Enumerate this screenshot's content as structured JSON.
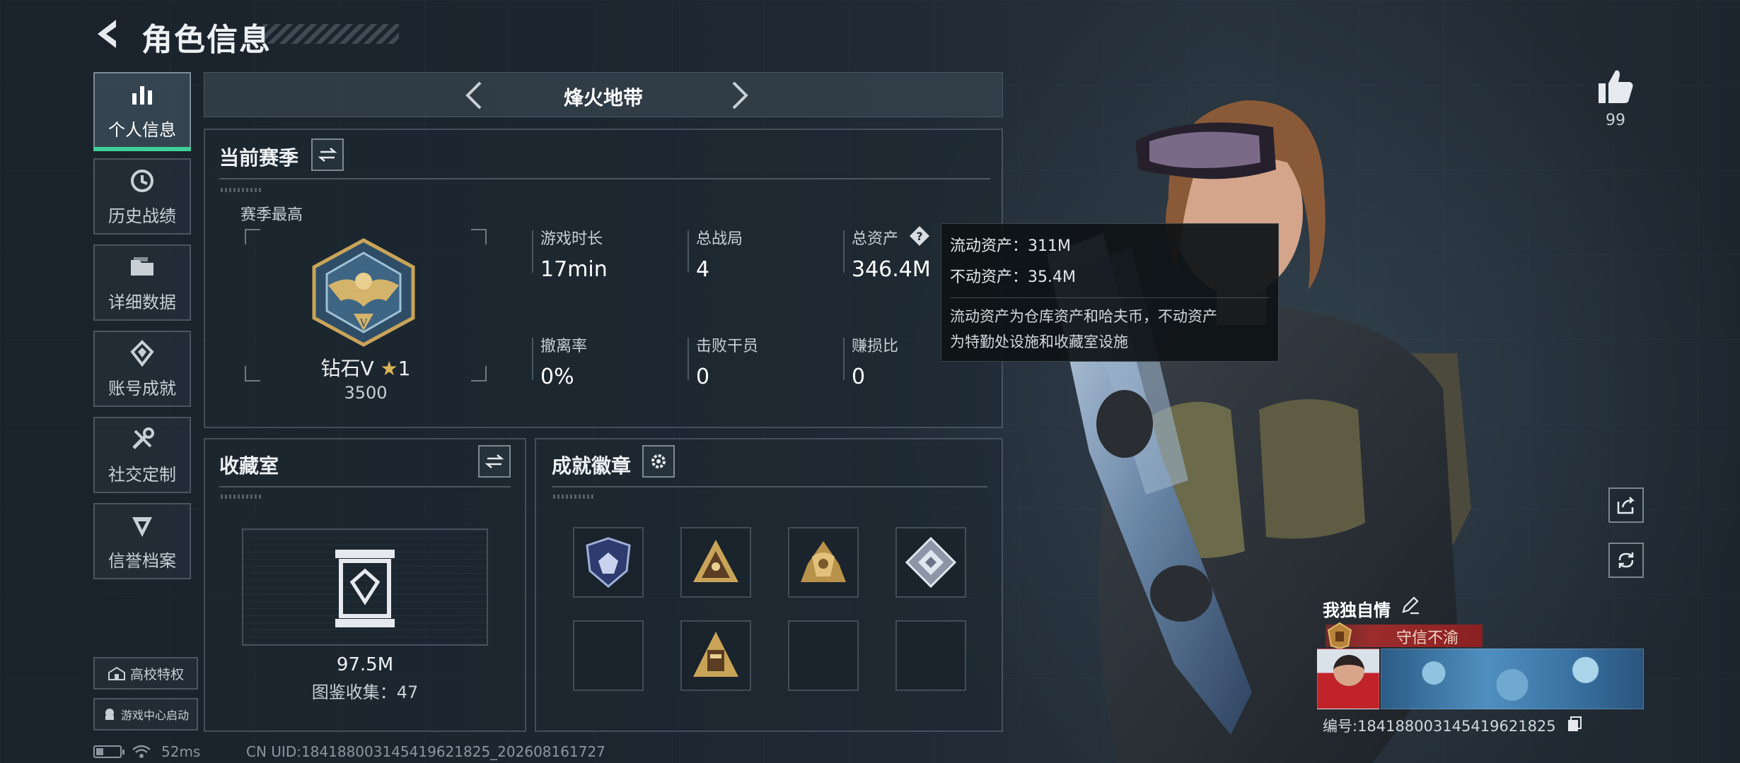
{
  "header": {
    "title": "角色信息"
  },
  "nav": {
    "items": [
      {
        "label": "个人信息",
        "icon": "bar-chart-icon",
        "active": true
      },
      {
        "label": "历史战绩",
        "icon": "history-icon",
        "active": false
      },
      {
        "label": "详细数据",
        "icon": "folder-icon",
        "active": false
      },
      {
        "label": "账号成就",
        "icon": "achievement-icon",
        "active": false
      },
      {
        "label": "社交定制",
        "icon": "tools-icon",
        "active": false
      },
      {
        "label": "信誉档案",
        "icon": "credit-icon",
        "active": false
      }
    ],
    "campus_label": "高校特权",
    "game_center_label": "游戏中心启动"
  },
  "status": {
    "ping": "52ms",
    "uid": "CN UID:1841880031454196218​25_202608161727"
  },
  "mode": {
    "title": "烽火地带"
  },
  "season": {
    "title": "当前赛季",
    "best_label": "赛季最高",
    "rank_name": "钻石V ",
    "rank_star": "★",
    "rank_stars": "1",
    "rank_score": "3500",
    "stats": [
      {
        "label": "游戏时长",
        "value": "17min"
      },
      {
        "label": "总战局",
        "value": "4"
      },
      {
        "label": "总资产",
        "value": "346.4M"
      },
      {
        "label": "撤离率",
        "value": "0%"
      },
      {
        "label": "击败干员",
        "value": "0"
      },
      {
        "label": "赚损比",
        "value": "0"
      }
    ]
  },
  "tooltip": {
    "liquid": "流动资产：311M",
    "fixed": "不动资产：35.4M",
    "note_line1": "流动资产为仓库资产和哈夫币，不动资产",
    "note_line2": "为特勤处设施和收藏室设施"
  },
  "collection": {
    "title": "收藏室",
    "value": "97.5M",
    "count": "图鉴收集：47"
  },
  "badges": {
    "title": "成就徽章",
    "slots": [
      {
        "icon": "shield-badge-icon",
        "filled": true
      },
      {
        "icon": "pyramid-badge-icon",
        "filled": true
      },
      {
        "icon": "gold-crest-badge-icon",
        "filled": true
      },
      {
        "icon": "diamond-badge-icon",
        "filled": true
      },
      {
        "icon": "",
        "filled": false
      },
      {
        "icon": "tower-badge-icon",
        "filled": true
      },
      {
        "icon": "",
        "filled": false
      },
      {
        "icon": "",
        "filled": false
      }
    ]
  },
  "profile": {
    "likes": "99",
    "name": "我独自情",
    "title_tag": "守信不渝",
    "id": "编号:1841880031454196218​25"
  },
  "colors": {
    "accent": "#3fd09a",
    "tag_red": "#9c2c2c"
  }
}
